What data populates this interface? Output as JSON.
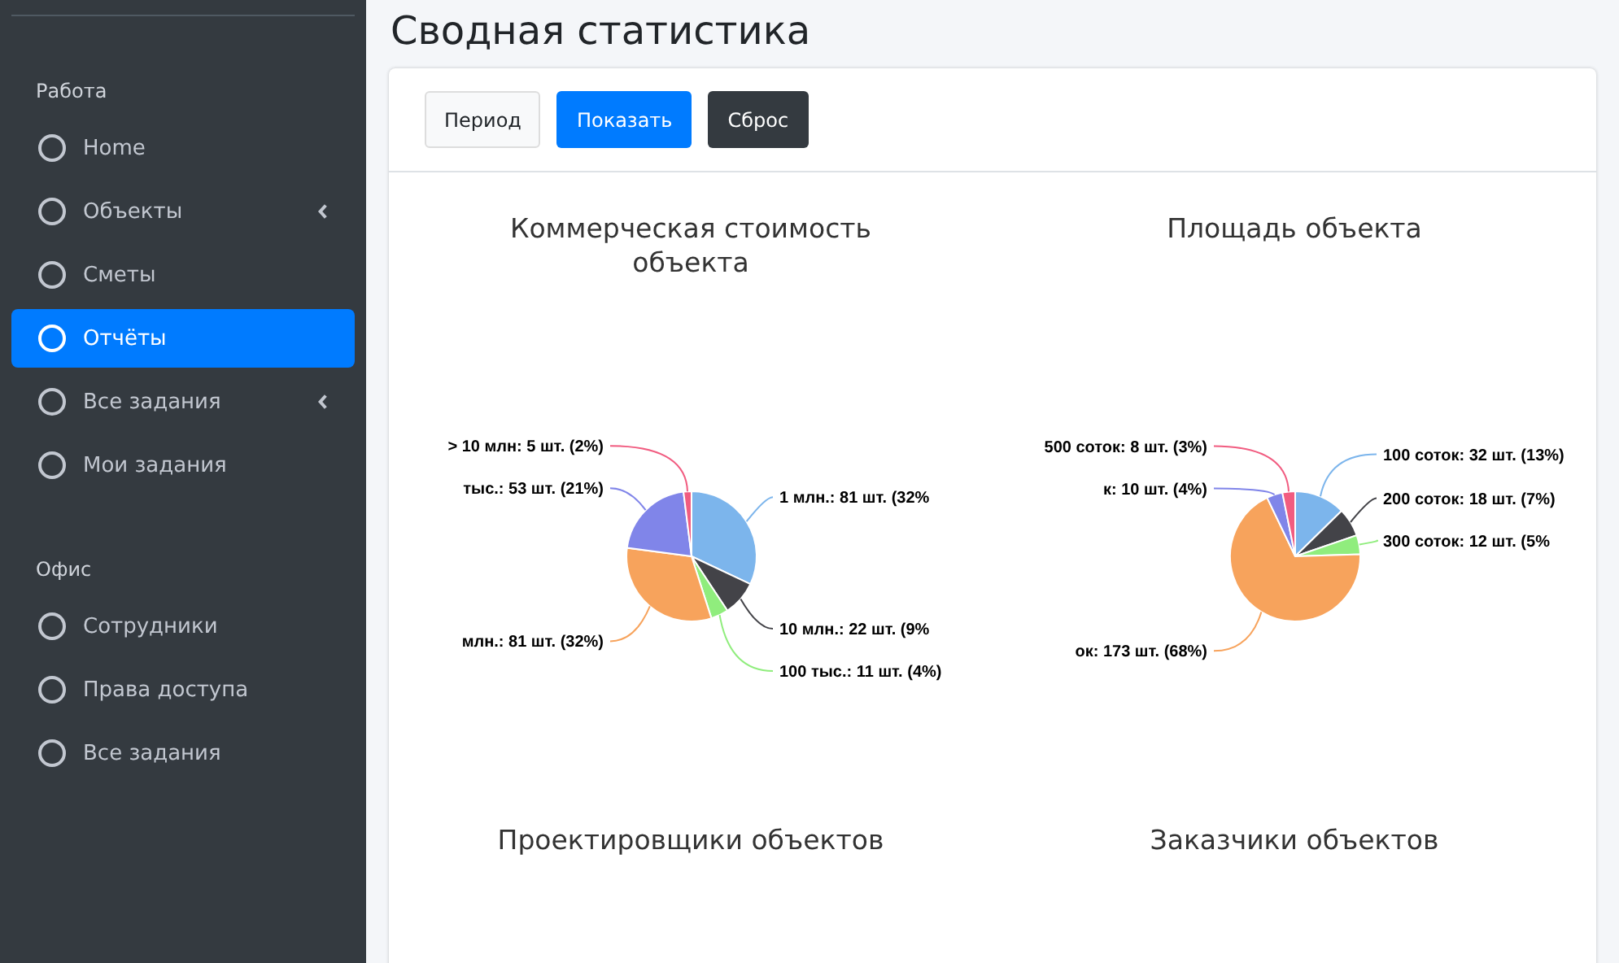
{
  "sidebar": {
    "sections": [
      {
        "header": "Работа",
        "items": [
          {
            "label": "Home",
            "selected": false,
            "expandable": false
          },
          {
            "label": "Объекты",
            "selected": false,
            "expandable": true
          },
          {
            "label": "Сметы",
            "selected": false,
            "expandable": false
          },
          {
            "label": "Отчёты",
            "selected": true,
            "expandable": false
          },
          {
            "label": "Все задания",
            "selected": false,
            "expandable": true
          },
          {
            "label": "Мои задания",
            "selected": false,
            "expandable": false
          }
        ]
      },
      {
        "header": "Офис",
        "items": [
          {
            "label": "Сотрудники",
            "selected": false,
            "expandable": false
          },
          {
            "label": "Права доступа",
            "selected": false,
            "expandable": false
          },
          {
            "label": "Все задания",
            "selected": false,
            "expandable": false
          }
        ]
      }
    ]
  },
  "page_title": "Сводная статистика",
  "toolbar": {
    "buttons": [
      {
        "label": "Период",
        "kind": "light"
      },
      {
        "label": "Показать",
        "kind": "primary"
      },
      {
        "label": "Сброс",
        "kind": "dark"
      }
    ]
  },
  "charts": [
    {
      "title": "Коммерческая стоимость объекта",
      "chart_data": {
        "type": "pie",
        "values": [
          81,
          22,
          11,
          81,
          53,
          5
        ],
        "colors": [
          "#7cb5ec",
          "#434348",
          "#90ed7d",
          "#f7a35c",
          "#8085e9",
          "#f15c80"
        ],
        "value_labels": [
          "1 млн.: 81 шт. (32%",
          "10 млн.: 22 шт. (9%",
          "100 тыс.: 11 шт. (4%)",
          "млн.: 81 шт. (32%)",
          "тыс.: 53 шт. (21%)",
          "> 10 млн: 5 шт. (2%)"
        ]
      }
    },
    {
      "title": "Площадь объекта",
      "chart_data": {
        "type": "pie",
        "values": [
          32,
          18,
          12,
          173,
          10,
          8
        ],
        "colors": [
          "#7cb5ec",
          "#434348",
          "#90ed7d",
          "#f7a35c",
          "#8085e9",
          "#f15c80"
        ],
        "value_labels": [
          "100 соток: 32 шт. (13%)",
          "200 соток: 18 шт. (7%)",
          "300 соток: 12 шт. (5%",
          "ок: 173 шт. (68%)",
          "к: 10 шт. (4%)",
          "500 соток: 8 шт. (3%)"
        ]
      }
    },
    {
      "title": "Проектировщики объектов"
    },
    {
      "title": "Заказчики объектов"
    }
  ]
}
